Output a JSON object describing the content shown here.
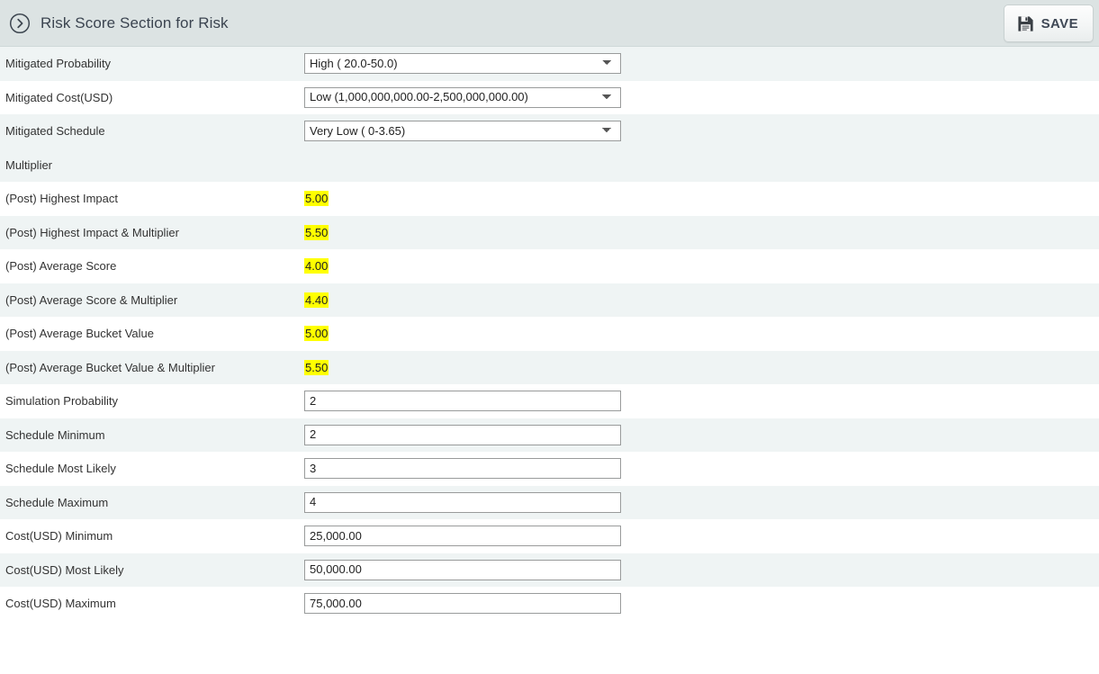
{
  "header": {
    "title": "Risk Score Section for Risk",
    "collapse_icon": "circle-chevron-right-icon",
    "save_label": "SAVE",
    "save_icon": "floppy-disk-icon",
    "background_color": "#dce3e3"
  },
  "colors": {
    "row_alt": "#eff4f4",
    "row_plain": "#ffffff",
    "highlight": "#ffff00",
    "text": "#333333",
    "control_border": "#999b9b"
  },
  "form": {
    "rows": [
      {
        "label": "Mitigated Probability",
        "type": "select",
        "value": "High ( 20.0-50.0)",
        "name": "mitigated-probability",
        "stripe": "alt"
      },
      {
        "label": "Mitigated Cost(USD)",
        "type": "select",
        "value": "Low (1,000,000,000.00-2,500,000,000.00)",
        "name": "mitigated-cost-usd",
        "stripe": "plain"
      },
      {
        "label": "Mitigated Schedule",
        "label2": "Multiplier",
        "type": "select-stacked",
        "value": "Very Low ( 0-3.65)",
        "name": "mitigated-schedule",
        "stripe": "alt"
      },
      {
        "label": "(Post) Highest Impact",
        "type": "highlight",
        "value": "5.00",
        "name": "post-highest-impact",
        "stripe": "plain"
      },
      {
        "label": "(Post) Highest Impact & Multiplier",
        "type": "highlight",
        "value": "5.50",
        "name": "post-highest-impact-multiplier",
        "stripe": "alt"
      },
      {
        "label": "(Post) Average Score",
        "type": "highlight",
        "value": "4.00",
        "name": "post-average-score",
        "stripe": "plain"
      },
      {
        "label": "(Post) Average Score & Multiplier",
        "type": "highlight",
        "value": "4.40",
        "name": "post-average-score-multiplier",
        "stripe": "alt"
      },
      {
        "label": "(Post) Average Bucket Value",
        "type": "highlight",
        "value": "5.00",
        "name": "post-average-bucket-value",
        "stripe": "plain"
      },
      {
        "label": "(Post) Average Bucket Value & Multiplier",
        "type": "highlight",
        "value": "5.50",
        "name": "post-average-bucket-value-multiplier",
        "stripe": "alt"
      },
      {
        "label": "Simulation Probability",
        "type": "input",
        "value": "2",
        "name": "simulation-probability",
        "stripe": "plain"
      },
      {
        "label": "Schedule Minimum",
        "type": "input",
        "value": "2",
        "name": "schedule-minimum",
        "stripe": "alt"
      },
      {
        "label": "Schedule Most Likely",
        "type": "input",
        "value": "3",
        "name": "schedule-most-likely",
        "stripe": "plain"
      },
      {
        "label": "Schedule Maximum",
        "type": "input",
        "value": "4",
        "name": "schedule-maximum",
        "stripe": "alt"
      },
      {
        "label": "Cost(USD) Minimum",
        "type": "input",
        "value": "25,000.00",
        "name": "cost-usd-minimum",
        "stripe": "plain"
      },
      {
        "label": "Cost(USD) Most Likely",
        "type": "input",
        "value": "50,000.00",
        "name": "cost-usd-most-likely",
        "stripe": "alt"
      },
      {
        "label": "Cost(USD) Maximum",
        "type": "input",
        "value": "75,000.00",
        "name": "cost-usd-maximum",
        "stripe": "plain"
      }
    ]
  }
}
